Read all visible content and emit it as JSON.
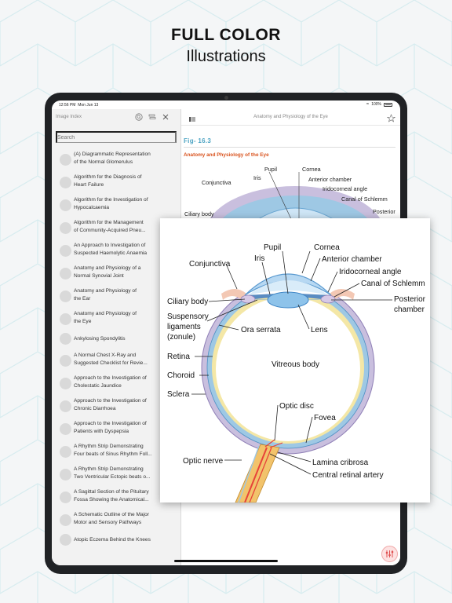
{
  "headline": {
    "line1": "FULL COLOR",
    "line2": "Illustrations"
  },
  "status_bar": {
    "time": "12:56 PM",
    "date": "Mon Jun 13",
    "battery": "100%"
  },
  "sidebar": {
    "title": "Image Index",
    "search_placeholder": "Search",
    "items": [
      {
        "label": "(A) Diagrammatic Representation\nof the Normal Glomerulus"
      },
      {
        "label": "Algorithm for the Diagnosis of\nHeart Failure"
      },
      {
        "label": "Algorithm for the Investigation of\nHypocalcaemia"
      },
      {
        "label": "Algorithm for the Management\nof Community-Acquired Pneu..."
      },
      {
        "label": "An Approach to Investigation of\nSuspected Haemolytic Anaemia"
      },
      {
        "label": "Anatomy and Physiology of a\nNormal Synovial Joint"
      },
      {
        "label": "Anatomy and Physiology of\nthe Ear"
      },
      {
        "label": "Anatomy and Physiology of\nthe Eye"
      },
      {
        "label": "Ankylosing Spondylitis"
      },
      {
        "label": "A Normal Chest X-Ray and\nSuggested Checklist for Revie..."
      },
      {
        "label": "Approach to the Investigation of\nCholestatic Jaundice"
      },
      {
        "label": "Approach to the Investigation of\nChronic Diarrhoea"
      },
      {
        "label": "Approach to the Investigation of\nPatients with Dyspepsia"
      },
      {
        "label": "A Rhythm Strip Demonstrating\nFour beats of Sinus Rhythm Foll..."
      },
      {
        "label": "A Rhythm Strip Demonstrating\nTwo Ventricular Ectopic beats o..."
      },
      {
        "label": "A Sagittal Section of the Pituitary\nFossa Showing the Anatomical..."
      },
      {
        "label": "A Schematic Outline of the Major\nMotor and Sensory Pathways"
      },
      {
        "label": "Atopic Eczema Behind the Knees"
      }
    ]
  },
  "main": {
    "title": "Anatomy and Physiology of the Eye",
    "fig_label": "Fig- 16.3",
    "fig_title": "Anatomy and Physiology of the Eye",
    "bg_labels": [
      "Pupil",
      "Cornea",
      "Iris",
      "Anterior chamber",
      "Conjunctiva",
      "Iridocorneal angle",
      "Canal of Schlemm",
      "Ciliary body",
      "Posterior"
    ]
  },
  "diagram": {
    "labels": {
      "pupil": "Pupil",
      "cornea": "Cornea",
      "iris": "Iris",
      "anterior_chamber": "Anterior chamber",
      "conjunctiva": "Conjunctiva",
      "iridocorneal_angle": "Iridocorneal angle",
      "canal_schlemm": "Canal of Schlemm",
      "ciliary_body": "Ciliary body",
      "posterior_chamber_1": "Posterior",
      "posterior_chamber_2": "chamber",
      "suspensory_1": "Suspensory",
      "suspensory_2": "ligaments",
      "suspensory_3": "(zonule)",
      "ora_serrata": "Ora serrata",
      "lens": "Lens",
      "retina": "Retina",
      "vitreous": "Vitreous body",
      "choroid": "Choroid",
      "sclera": "Sclera",
      "optic_disc": "Optic disc",
      "fovea": "Fovea",
      "optic_nerve": "Optic nerve",
      "lamina": "Lamina cribrosa",
      "central_artery": "Central retinal artery"
    },
    "colors": {
      "sclera": "#c9bfde",
      "choroid": "#9ec8e4",
      "retina": "#f4e7a6",
      "vitreous": "#ffffff",
      "lens": "#8ec3ea",
      "cornea": "#cfe6f7",
      "vessel": "#e7433a"
    }
  }
}
